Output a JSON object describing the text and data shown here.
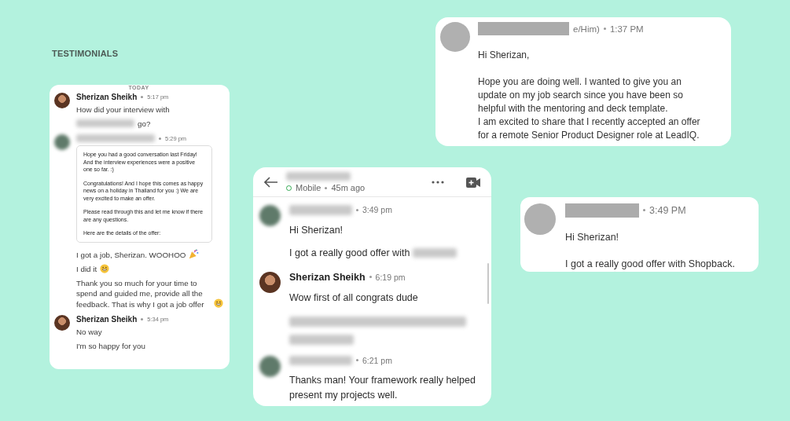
{
  "heading": "TESTIMONIALS",
  "chat_thread": {
    "date_label": "TODAY",
    "messages": [
      {
        "kind": "mentor",
        "sender": "Sherizan Sheikh",
        "time": "5:17 pm",
        "body": [
          {
            "kind": "text",
            "text": "How did your interview with"
          },
          {
            "kind": "blurred_lead",
            "text": "go?"
          }
        ]
      },
      {
        "kind": "mentee",
        "time": "5:29 pm",
        "body": [
          {
            "kind": "quote",
            "paragraphs": [
              "Hope you had a good conversation last Friday! And the interview experiences were a positive one so far. :)",
              "Congratulations! And I hope this comes as happy news on a holiday in Thailand for you :) We are very excited to make an offer.",
              "Please read through this and let me know if there are any questions.",
              "Here are the details of the offer:"
            ]
          },
          {
            "kind": "party_text",
            "text": "I got a job, Sherizan. WOOHOO"
          },
          {
            "kind": "grin_text",
            "text": "I did it"
          },
          {
            "kind": "smile_text",
            "text": "Thank you so much for your time to spend and guided me, provide all the feedback. That is why I got a job offer"
          }
        ]
      },
      {
        "kind": "mentor",
        "sender": "Sherizan Sheikh",
        "time": "5:34 pm",
        "body": [
          {
            "kind": "text",
            "text": "No way"
          },
          {
            "kind": "text",
            "text": "I'm so happy for you"
          }
        ]
      }
    ]
  },
  "mobile_chat": {
    "header": {
      "online": true,
      "status": "Mobile",
      "last_seen": "45m ago"
    },
    "messages": [
      {
        "kind": "mentee",
        "time": "3:49 pm",
        "body": [
          {
            "kind": "text",
            "text": "Hi Sherizan!"
          },
          {
            "kind": "blurred_tail",
            "text": "I got a really good offer with"
          }
        ]
      },
      {
        "kind": "mentor",
        "sender": "Sherizan Sheikh",
        "time": "6:19 pm",
        "body": [
          {
            "kind": "text",
            "text": "Wow first of all congrats dude"
          },
          {
            "kind": "blurred"
          }
        ]
      },
      {
        "kind": "mentee",
        "time": "6:21 pm",
        "body": [
          {
            "kind": "text",
            "text": "Thanks man! Your framework really helped present my projects well."
          }
        ]
      }
    ]
  },
  "message_card_1": {
    "kind": "anonymized",
    "sender_tail": "e/Him)",
    "time": "1:37 PM",
    "body": [
      {
        "kind": "text",
        "text": "Hi Sherizan,"
      },
      {
        "kind": "text",
        "text": "Hope you are doing well. I wanted to give you an update on my job search since you have been so helpful with the mentoring and deck template.\nI am excited to share that I recently accepted an offer for a remote Senior Product Designer role at LeadIQ."
      }
    ]
  },
  "message_card_2": {
    "kind": "anonymized",
    "time": "3:49 PM",
    "body": [
      {
        "kind": "text",
        "text": "Hi Sherizan!"
      },
      {
        "kind": "text",
        "text": "I got a really good offer with Shopback."
      }
    ]
  }
}
